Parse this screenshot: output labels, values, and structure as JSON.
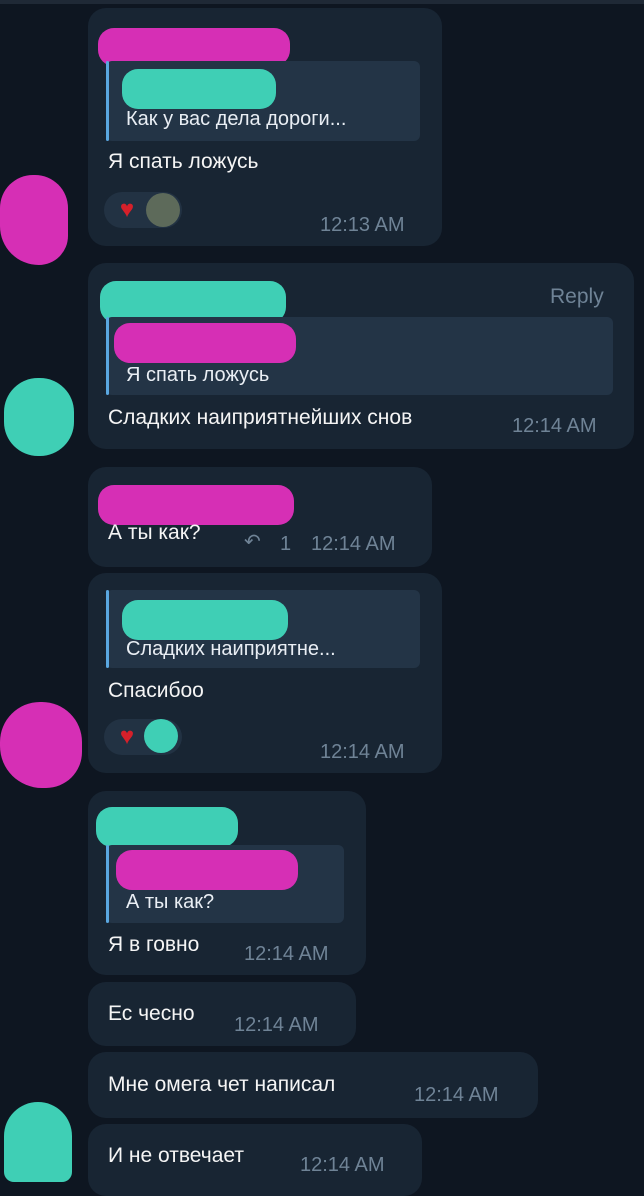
{
  "messages": [
    {
      "reply_preview": "Как у вас дела дороги...",
      "text": "Я спать ложусь",
      "time": "12:13 AM",
      "reactions": [
        "heart-icon",
        "avatar"
      ]
    },
    {
      "reply_button": "Reply",
      "reply_preview": "Я спать ложусь",
      "text": "Сладких наиприятнейших снов",
      "time": "12:14 AM"
    },
    {
      "text": "А ты как?",
      "reply_count": "1",
      "time": "12:14 AM"
    },
    {
      "reply_preview": "Сладких наиприятне...",
      "text": "Спасибоо",
      "time": "12:14 AM",
      "reactions": [
        "heart-icon",
        "avatar"
      ]
    },
    {
      "reply_preview": "А ты как?",
      "text": "Я в говно",
      "time": "12:14 AM"
    },
    {
      "text": "Ес чесно",
      "time": "12:14 AM"
    },
    {
      "text": "Мне омега чет написал",
      "time": "12:14 AM"
    },
    {
      "text": "И не отвечает",
      "time": "12:14 AM"
    }
  ],
  "icons": {
    "reply_arrow": "reply-arrow-icon",
    "heart": "heart-icon"
  },
  "colors": {
    "background": "#0e1621",
    "bubble": "#182533",
    "reply_accent": "#5aa7e0",
    "time": "#6f8396",
    "redaction_pink": "#d62fb5",
    "redaction_teal": "#3fcfb5"
  }
}
